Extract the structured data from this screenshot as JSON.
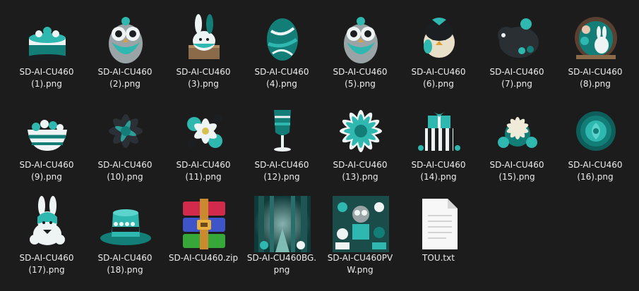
{
  "files": [
    {
      "name": "SD-AI-CU460\n(1).png",
      "icon": "cake-icon"
    },
    {
      "name": "SD-AI-CU460\n(2).png",
      "icon": "owl-icon"
    },
    {
      "name": "SD-AI-CU460\n(3).png",
      "icon": "bunny-icon"
    },
    {
      "name": "SD-AI-CU460\n(4).png",
      "icon": "egg-icon"
    },
    {
      "name": "SD-AI-CU460\n(5).png",
      "icon": "owl-icon"
    },
    {
      "name": "SD-AI-CU460\n(6).png",
      "icon": "chick-icon"
    },
    {
      "name": "SD-AI-CU460\n(7).png",
      "icon": "sheep-icon"
    },
    {
      "name": "SD-AI-CU460\n(8).png",
      "icon": "bunny-scene-icon"
    },
    {
      "name": "SD-AI-CU460\n(9).png",
      "icon": "egg-bowl-icon"
    },
    {
      "name": "SD-AI-CU460\n(10).png",
      "icon": "dark-flower-icon"
    },
    {
      "name": "SD-AI-CU460\n(11).png",
      "icon": "flower-cluster-icon"
    },
    {
      "name": "SD-AI-CU460\n(12).png",
      "icon": "wine-glass-icon"
    },
    {
      "name": "SD-AI-CU460\n(13).png",
      "icon": "teal-flower-icon"
    },
    {
      "name": "SD-AI-CU460\n(14).png",
      "icon": "gift-cake-icon"
    },
    {
      "name": "SD-AI-CU460\n(15).png",
      "icon": "lily-cluster-icon"
    },
    {
      "name": "SD-AI-CU460\n(16).png",
      "icon": "rose-icon"
    },
    {
      "name": "SD-AI-CU460\n(17).png",
      "icon": "plush-bunny-icon"
    },
    {
      "name": "SD-AI-CU460\n(18).png",
      "icon": "hat-icon"
    },
    {
      "name": "SD-AI-CU460.zip",
      "icon": "winrar-archive-icon"
    },
    {
      "name": "SD-AI-CU460BG.\npng",
      "icon": "forest-background-icon"
    },
    {
      "name": "SD-AI-CU460PV\nW.png",
      "icon": "preview-collage-icon"
    },
    {
      "name": "TOU.txt",
      "icon": "text-document-icon"
    }
  ],
  "colors": {
    "background": "#1c1c1c",
    "text": "#ececec",
    "teal": "#2fb8b0",
    "teal_dark": "#137d78"
  }
}
